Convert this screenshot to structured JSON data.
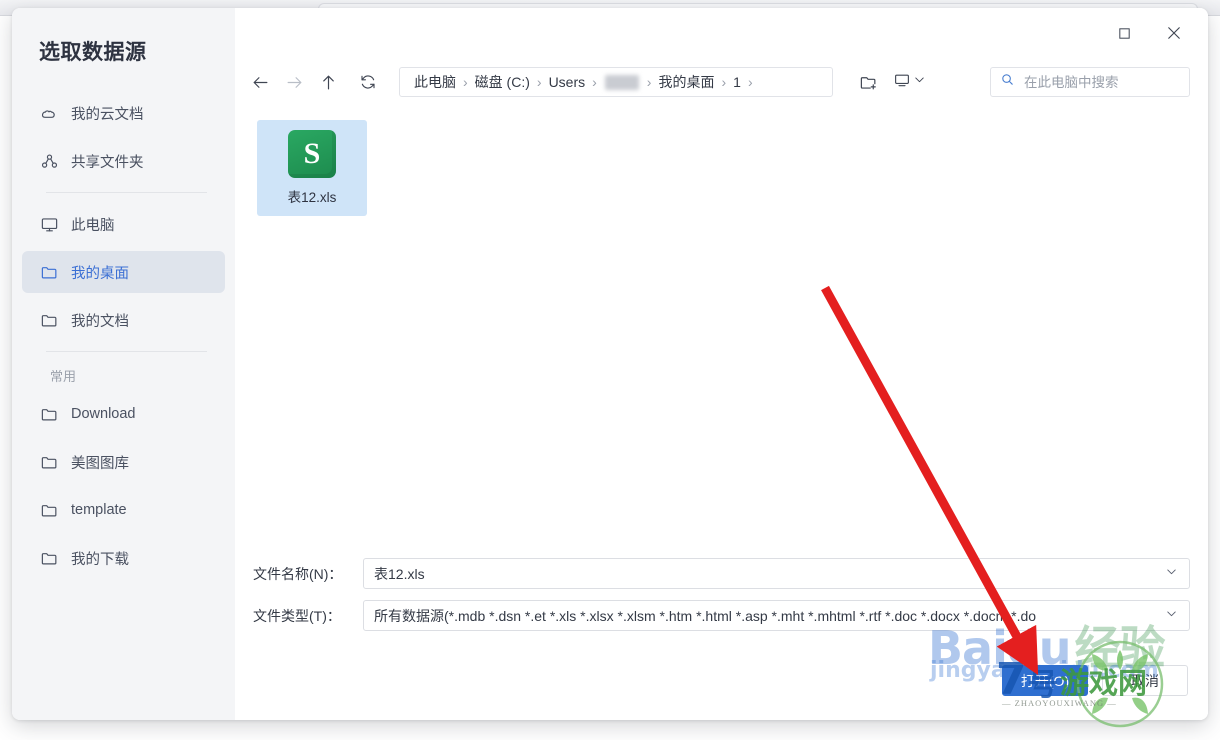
{
  "dialog": {
    "title": "选取数据源"
  },
  "window_controls": {
    "maximize": "maximize-icon",
    "close": "close-icon"
  },
  "sidebar": {
    "group_title": "常用",
    "items": [
      {
        "label": "我的云文档",
        "icon": "cloud-icon",
        "selected": false
      },
      {
        "label": "共享文件夹",
        "icon": "share-icon",
        "selected": false
      },
      {
        "label": "此电脑",
        "icon": "monitor-icon",
        "selected": false
      },
      {
        "label": "我的桌面",
        "icon": "folder-icon",
        "selected": true
      },
      {
        "label": "我的文档",
        "icon": "folder-icon",
        "selected": false
      },
      {
        "label": "Download",
        "icon": "folder-icon",
        "selected": false
      },
      {
        "label": "美图图库",
        "icon": "folder-icon",
        "selected": false
      },
      {
        "label": "template",
        "icon": "folder-icon",
        "selected": false
      },
      {
        "label": "我的下载",
        "icon": "folder-icon",
        "selected": false
      }
    ]
  },
  "toolbar": {
    "back": "arrow-left-icon",
    "forward": "arrow-right-icon",
    "up": "arrow-up-icon",
    "refresh": "refresh-icon",
    "new_folder": "new-folder-icon",
    "view_mode": "view-mode-icon",
    "breadcrumb": [
      "此电脑",
      "磁盘 (C:)",
      "Users",
      "",
      "我的桌面",
      "1"
    ]
  },
  "search": {
    "placeholder": "在此电脑中搜索",
    "value": "",
    "icon": "search-icon"
  },
  "files": [
    {
      "name": "表12.xls",
      "icon_letter": "S",
      "selected": true
    }
  ],
  "fields": {
    "filename": {
      "label": "文件名称(N)：",
      "value": "表12.xls"
    },
    "filetype": {
      "label": "文件类型(T)：",
      "value": "所有数据源(*.mdb *.dsn *.et *.xls *.xlsx *.xlsm *.htm *.html *.asp *.mht *.mhtml *.rtf *.doc *.docx *.docm *.do"
    }
  },
  "buttons": {
    "open": "打开(O)",
    "cancel": "取消"
  },
  "colors": {
    "accent": "#2f6fd0",
    "selection": "#cfe4f8",
    "sidebar_bg": "#f4f5f7",
    "sidebar_selected": "#dfe4ec",
    "excel_green": "#1d8b4e",
    "annotation_red": "#e41f1f"
  },
  "annotations": {
    "arrow": "red-arrow-pointing-to-open-button"
  },
  "watermarks": {
    "baidu_main": "Baidu",
    "baidu_cn": "经验",
    "baidu_url": "jingyan.baidu.com",
    "site_num": "7",
    "site_hao": "号",
    "site_cn": "游戏网",
    "site_pinyin": "— ZHAOYOUXIWANG —"
  }
}
